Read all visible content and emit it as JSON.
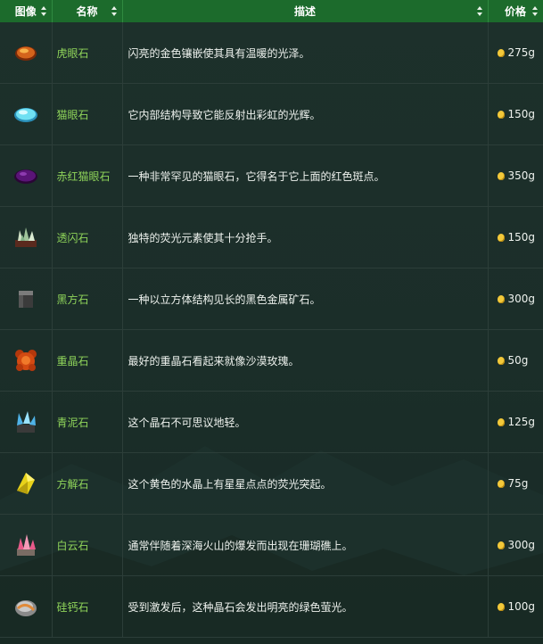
{
  "columns": {
    "image": "图像",
    "name": "名称",
    "description": "描述",
    "price": "价格"
  },
  "rows": [
    {
      "icon": "tigers-eye-icon",
      "name": "虎眼石",
      "description": "闪亮的金色镶嵌使其具有温暖的光泽。",
      "price": "275g"
    },
    {
      "icon": "opal-icon",
      "name": "猫眼石",
      "description": "它内部结构导致它能反射出彩虹的光辉。",
      "price": "150g"
    },
    {
      "icon": "fire-opal-icon",
      "name": "赤红猫眼石",
      "description": "一种非常罕见的猫眼石，它得名于它上面的红色斑点。",
      "price": "350g"
    },
    {
      "icon": "fluorapatite-icon",
      "name": "透闪石",
      "description": "独特的荧光元素使其十分抢手。",
      "price": "150g"
    },
    {
      "icon": "obsidian-cube-icon",
      "name": "黑方石",
      "description": "一种以立方体结构见长的黑色金属矿石。",
      "price": "300g"
    },
    {
      "icon": "baryte-icon",
      "name": "重晶石",
      "description": "最好的重晶石看起来就像沙漠玫瑰。",
      "price": "50g"
    },
    {
      "icon": "celestine-icon",
      "name": "青泥石",
      "description": "这个晶石不可思议地轻。",
      "price": "125g"
    },
    {
      "icon": "calcite-icon",
      "name": "方解石",
      "description": "这个黄色的水晶上有星星点点的荧光突起。",
      "price": "75g"
    },
    {
      "icon": "aerinite-icon",
      "name": "白云石",
      "description": "通常伴随着深海火山的爆发而出现在珊瑚礁上。",
      "price": "300g"
    },
    {
      "icon": "esperite-icon",
      "name": "硅钙石",
      "description": "受到激发后，这种晶石会发出明亮的绿色萤光。",
      "price": "100g"
    }
  ],
  "colors": {
    "header_bg": "#1c6b2c",
    "name_text": "#8fd45a",
    "page_bg": "#1b2e29",
    "coin": "#f3c93a"
  }
}
